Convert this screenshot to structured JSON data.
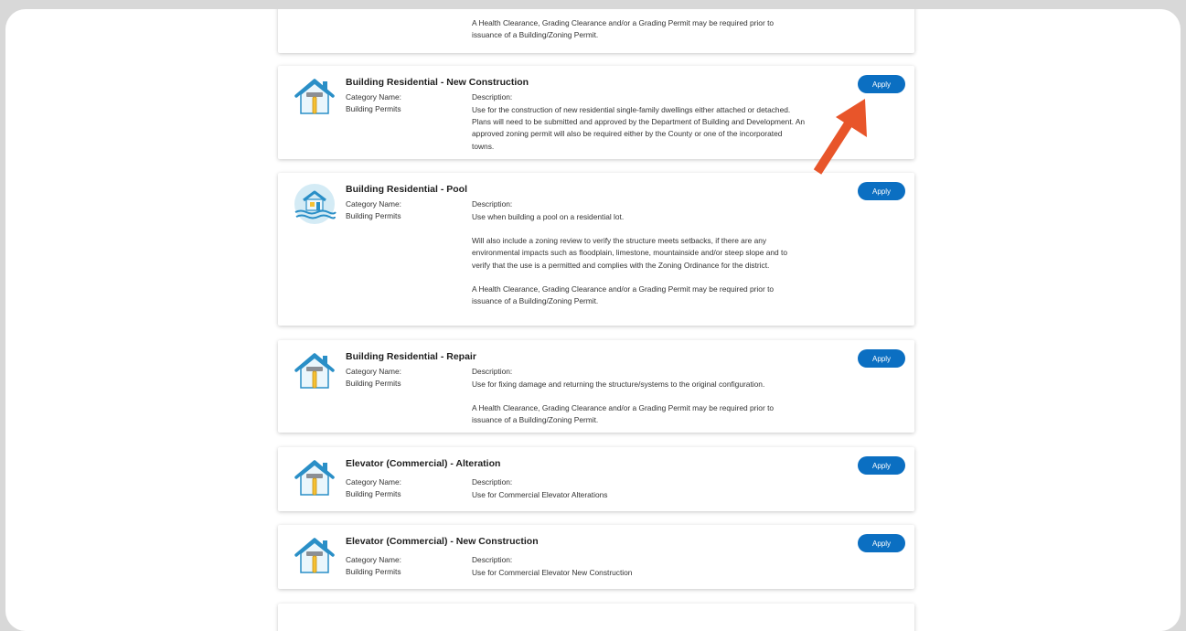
{
  "cards": [
    {
      "title": "",
      "category_label": "",
      "category_value": "",
      "description_label": "",
      "desc": [
        "A Health Clearance, Grading Clearance and/or a Grading Permit may be required prior to issuance of a Building/Zoning Permit."
      ],
      "apply_label": "",
      "icon": "none"
    },
    {
      "title": "Building Residential - New Construction",
      "category_label": "Category Name:",
      "category_value": "Building Permits",
      "description_label": "Description:",
      "desc": [
        "Use for the construction of new residential single-family dwellings either attached or detached. Plans will need to be submitted and approved by the Department of Building and Development. An approved zoning permit will also be required either by the County or one of the incorporated towns."
      ],
      "apply_label": "Apply",
      "icon": "house-hammer-icon"
    },
    {
      "title": "Building Residential - Pool",
      "category_label": "Category Name:",
      "category_value": "Building Permits",
      "description_label": "Description:",
      "desc": [
        "Use when building a pool on a residential lot.",
        "Will also include a zoning review to verify the structure meets setbacks, if there are any environmental impacts such as floodplain, limestone, mountainside and/or steep slope and to verify that the use is a permitted and complies with the Zoning Ordinance for the district.",
        "A Health Clearance, Grading Clearance and/or a Grading Permit may be required prior to issuance of a Building/Zoning Permit."
      ],
      "apply_label": "Apply",
      "icon": "pool-house-icon"
    },
    {
      "title": "Building Residential - Repair",
      "category_label": "Category Name:",
      "category_value": "Building Permits",
      "description_label": "Description:",
      "desc": [
        "Use for fixing damage and returning the structure/systems to the original configuration.",
        "A Health Clearance, Grading Clearance and/or a Grading Permit may be required prior to issuance of a Building/Zoning Permit."
      ],
      "apply_label": "Apply",
      "icon": "house-hammer-icon"
    },
    {
      "title": "Elevator (Commercial) - Alteration",
      "category_label": "Category Name:",
      "category_value": "Building Permits",
      "description_label": "Description:",
      "desc": [
        "Use for Commercial Elevator Alterations"
      ],
      "apply_label": "Apply",
      "icon": "house-hammer-icon"
    },
    {
      "title": "Elevator (Commercial) - New Construction",
      "category_label": "Category Name:",
      "category_value": "Building Permits",
      "description_label": "Description:",
      "desc": [
        "Use for Commercial Elevator New Construction"
      ],
      "apply_label": "Apply",
      "icon": "house-hammer-icon"
    }
  ],
  "colors": {
    "apply_button": "#0b6fc2",
    "arrow": "#e8552a",
    "icon_blue": "#2a8fc7",
    "icon_yellow": "#f5c033"
  }
}
